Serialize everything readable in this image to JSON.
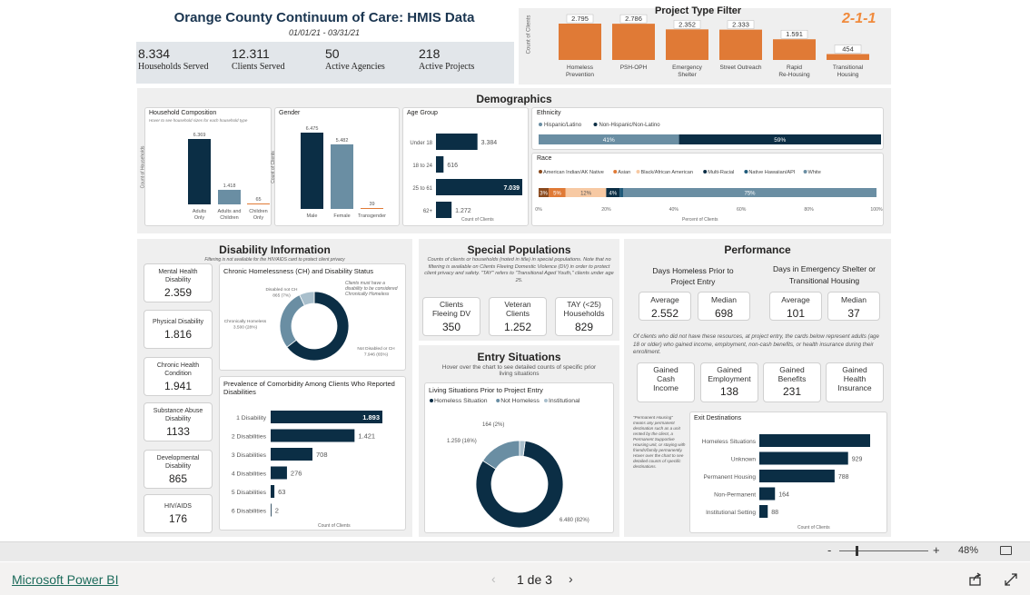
{
  "header": {
    "title": "Orange County Continuum of Care: HMIS Data",
    "date_range": "01/01/21 - 03/31/21",
    "stats": [
      {
        "value": "8.334",
        "label": "Households Served"
      },
      {
        "value": "12.311",
        "label": "Clients Served"
      },
      {
        "value": "50",
        "label": "Active Agencies"
      },
      {
        "value": "218",
        "label": "Active Projects"
      }
    ]
  },
  "project_filter": {
    "title": "Project Type Filter",
    "y_axis_label": "Count of Clients",
    "logo_text": "2-1-1"
  },
  "demographics": {
    "title": "Demographics",
    "household": {
      "title": "Household Composition",
      "note": "Hover to see household sizes for each household type",
      "y_label": "Count of Households"
    },
    "gender": {
      "title": "Gender",
      "y_label": "Count of Clients"
    },
    "age": {
      "title": "Age Group",
      "x_label": "Count of Clients"
    },
    "ethnicity": {
      "title": "Ethnicity"
    },
    "race": {
      "title": "Race",
      "x_label": "Percent of Clients"
    }
  },
  "disability": {
    "title": "Disability Information",
    "note": "Filtering is not available for the HIV/AIDS card to protect client privacy",
    "cards": [
      {
        "label": "Mental Health Disability",
        "value": "2.359"
      },
      {
        "label": "Physical Disability",
        "value": "1.816"
      },
      {
        "label": "Chronic Health Condition",
        "value": "1.941"
      },
      {
        "label": "Substance Abuse Disability",
        "value": "1133"
      },
      {
        "label": "Developmental Disability",
        "value": "865"
      },
      {
        "label": "HIV/AIDS",
        "value": "176"
      }
    ],
    "ch_title": "Chronic Homelessness (CH) and Disability Status",
    "ch_note": "Clients must have a disability to be considered Chronically Homeless",
    "comorb_title": "Prevalence of Comorbidity Among Clients Who Reported Disabilities",
    "comorb_x_label": "Count of Clients"
  },
  "special": {
    "title": "Special Populations",
    "note": "Counts of clients or households (noted in title) in special populations. Note that no filtering is available on Clients Fleeing Domestic Violence (DV) in order to protect client privacy and safety. \"TAY\" refers to \"Transitional Aged Youth,\" clients under age 25.",
    "cards": [
      {
        "label": "Clients Fleeing DV",
        "value": "350"
      },
      {
        "label": "Veteran Clients",
        "value": "1.252"
      },
      {
        "label": "TAY (<25) Households",
        "value": "829"
      }
    ]
  },
  "entry": {
    "title": "Entry Situations",
    "note": "Hover over the chart to see detailed counts of specific prior living situations",
    "chart_title": "Living Situations Prior to Project Entry"
  },
  "performance": {
    "title": "Performance",
    "days_homeless_title": "Days Homeless Prior to Project Entry",
    "days_shelter_title": "Days in Emergency Shelter or Transitional Housing",
    "kpis": [
      {
        "label": "Average",
        "value": "2.552"
      },
      {
        "label": "Median",
        "value": "698"
      },
      {
        "label": "Average",
        "value": "101"
      },
      {
        "label": "Median",
        "value": "37"
      }
    ],
    "income_note": "Of clients who did not have these resources, at project entry, the cards below represent adults (age 18 or older) who gained income, employment, non-cash benefits, or health insurance during their enrollment.",
    "gained": [
      {
        "label": "Gained Cash Income",
        "value": ""
      },
      {
        "label": "Gained Employment",
        "value": "138"
      },
      {
        "label": "Gained Benefits",
        "value": "231"
      },
      {
        "label": "Gained Health Insurance",
        "value": ""
      }
    ],
    "perm_note": "\"Permanent Housing\" means any permanent destination such as a unit rented by the client, a Permanent Supportive Housing unit, or staying with friends/family permanently. Hover over the chart to see detailed counts of specific destinations.",
    "exit_title": "Exit Destinations",
    "exit_x_label": "Count of Clients"
  },
  "footer": {
    "zoom": "48%",
    "brand": "Microsoft Power BI",
    "page": "1 de 3",
    "minus": "-",
    "plus": "+"
  },
  "colors": {
    "navy": "#0b2e45",
    "blue": "#6a8ea3",
    "orange": "#e07a36",
    "light_blue": "#a9bfcc",
    "peach": "#f7c9a3"
  },
  "chart_data": [
    {
      "type": "bar",
      "id": "project_type",
      "categories": [
        "Homeless Prevention",
        "PSH-OPH",
        "Emergency Shelter",
        "Street Outreach",
        "Rapid Re-Housing",
        "Transitional Housing"
      ],
      "values": [
        2795,
        2786,
        2352,
        2333,
        1591,
        454
      ],
      "value_labels": [
        "2.795",
        "2.786",
        "2.352",
        "2.333",
        "1.591",
        "454"
      ]
    },
    {
      "type": "bar",
      "id": "household",
      "categories": [
        "Adults Only",
        "Adults and Children",
        "Children Only"
      ],
      "values": [
        6369,
        1418,
        65
      ],
      "value_labels": [
        "6.369",
        "1.418",
        "65"
      ]
    },
    {
      "type": "bar",
      "id": "gender",
      "categories": [
        "Male",
        "Female",
        "Transgender"
      ],
      "values": [
        6475,
        5482,
        39
      ],
      "value_labels": [
        "6.475",
        "5.482",
        "39"
      ]
    },
    {
      "type": "bar",
      "id": "age",
      "orientation": "horizontal",
      "categories": [
        "Under 18",
        "18 to 24",
        "25 to 61",
        "62+"
      ],
      "values": [
        3384,
        616,
        7039,
        1272
      ],
      "value_labels": [
        "3.384",
        "616",
        "7.039",
        "1.272"
      ]
    },
    {
      "type": "bar",
      "id": "ethnicity",
      "orientation": "stacked-100",
      "series": [
        {
          "name": "Hispanic/Latino",
          "values": [
            41
          ]
        },
        {
          "name": "Non-Hispanic/Non-Latino",
          "values": [
            59
          ]
        }
      ]
    },
    {
      "type": "bar",
      "id": "race",
      "orientation": "stacked-100",
      "series": [
        {
          "name": "American Indian/AK Native",
          "values": [
            3
          ]
        },
        {
          "name": "Asian",
          "values": [
            5
          ]
        },
        {
          "name": "Black/African American",
          "values": [
            12
          ]
        },
        {
          "name": "Multi-Racial",
          "values": [
            4
          ]
        },
        {
          "name": "Native Hawaiian/API",
          "values": [
            1
          ]
        },
        {
          "name": "White",
          "values": [
            75
          ]
        }
      ],
      "value_labels": [
        "3%",
        "5%",
        "12%",
        "4%",
        "",
        "75%"
      ],
      "x_ticks": [
        "0%",
        "20%",
        "40%",
        "60%",
        "80%",
        "100%"
      ]
    },
    {
      "type": "pie",
      "id": "chronic_homelessness",
      "slices": [
        {
          "label": "Disabled not CH",
          "value": 865,
          "text": "Disabled not CH 865 (7%)"
        },
        {
          "label": "Chronically Homeless",
          "value": 3500,
          "text": "Chronically Homeless 3.500 (28%)"
        },
        {
          "label": "Not Disabled or CH",
          "value": 7946,
          "text": "Not Disabled or CH 7.946 (65%)"
        }
      ]
    },
    {
      "type": "bar",
      "id": "comorbidity",
      "orientation": "horizontal",
      "categories": [
        "1 Disability",
        "2 Disabilities",
        "3 Disabilities",
        "4 Disabilities",
        "5 Disabilities",
        "6 Disabilities"
      ],
      "values": [
        1893,
        1421,
        708,
        276,
        63,
        2
      ],
      "value_labels": [
        "1.893",
        "1.421",
        "708",
        "276",
        "63",
        "2"
      ]
    },
    {
      "type": "pie",
      "id": "living_situations",
      "series_names": [
        "Homeless Situation",
        "Not Homeless",
        "Institutional"
      ],
      "slices": [
        {
          "label": "Homeless Situation",
          "value": 6480,
          "text": "6.480 (82%)"
        },
        {
          "label": "Not Homeless",
          "value": 1259,
          "text": "1.259 (16%)"
        },
        {
          "label": "Institutional",
          "value": 164,
          "text": "164 (2%)"
        }
      ]
    },
    {
      "type": "bar",
      "id": "exit_destinations",
      "orientation": "horizontal",
      "categories": [
        "Homeless Situations",
        "Unknown",
        "Permanent Housing",
        "Non-Permanent",
        "Institutional Setting"
      ],
      "values": [
        1160,
        929,
        788,
        164,
        88
      ],
      "value_labels": [
        "",
        "929",
        "788",
        "164",
        "88"
      ]
    }
  ]
}
